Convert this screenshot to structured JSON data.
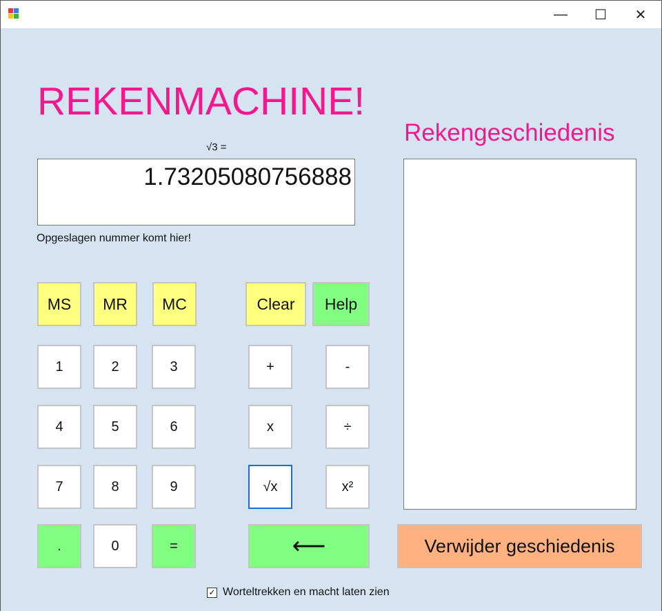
{
  "window": {
    "controls": {
      "minimize": "—",
      "maximize": "☐",
      "close": "✕"
    }
  },
  "app": {
    "title": "REKENMACHINE!",
    "history_title": "Rekengeschiedenis",
    "expression": "√3 =",
    "display_value": "1.73205080756888",
    "memory_label": "Opgeslagen nummer komt hier!",
    "history_items": []
  },
  "buttons": {
    "ms": "MS",
    "mr": "MR",
    "mc": "MC",
    "clear": "Clear",
    "help": "Help",
    "d1": "1",
    "d2": "2",
    "d3": "3",
    "plus": "+",
    "minus": "-",
    "d4": "4",
    "d5": "5",
    "d6": "6",
    "times": "x",
    "divide": "÷",
    "d7": "7",
    "d8": "8",
    "d9": "9",
    "sqrt": "√x",
    "square": "x²",
    "dot": ".",
    "d0": "0",
    "equals": "=",
    "backspace": "⟵",
    "clear_history": "Verwijder geschiedenis"
  },
  "checkbox": {
    "label": "Worteltrekken en macht laten zien",
    "checked": true,
    "mark": "✓"
  },
  "colors": {
    "pink": "#f3198d",
    "background": "#d6e3f1",
    "yellow": "#ffff80",
    "green": "#80ff80",
    "orange": "#ffb27f"
  },
  "icons": {
    "app": "app-icon"
  }
}
